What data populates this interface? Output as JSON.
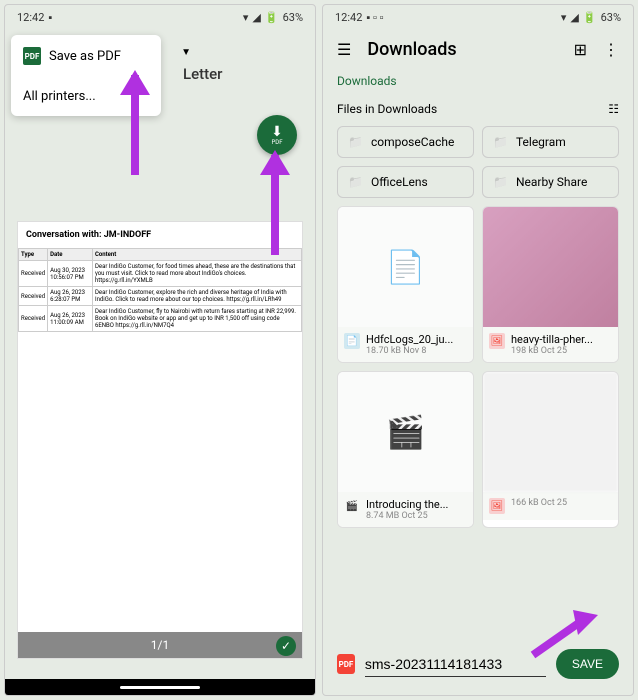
{
  "status": {
    "time": "12:42",
    "battery": "63%"
  },
  "left": {
    "dropdown": {
      "save_as_pdf": "Save as PDF",
      "all_printers": "All printers..."
    },
    "paper": "Letter",
    "preview": {
      "title": "Conversation with: JM-INDOFF",
      "headers": [
        "Type",
        "Date",
        "Content"
      ],
      "rows": [
        {
          "type": "Received",
          "date": "Aug 30, 2023 10:56:07 PM",
          "content": "Dear IndiGo Customer, for food times ahead, these are the destinations that you must visit. Click to read more about IndiGo's choices. https://g.rll.in/YXMLB"
        },
        {
          "type": "Received",
          "date": "Aug 26, 2023 6:28:07 PM",
          "content": "Dear IndiGo Customer, explore the rich and diverse heritage of India with IndiGo. Click to read more about our top choices. https://g.rll.in/LRh49"
        },
        {
          "type": "Received",
          "date": "Aug 26, 2023 11:00:09 AM",
          "content": "Dear IndiGo Customer, fly to Nairobi with return fares starting at INR 22,999. Book on IndiGo website or app and get up to INR 1,500 off using code 6ENBO https://g.rll.in/NM7Q4"
        }
      ],
      "page_indicator": "1/1"
    }
  },
  "right": {
    "title": "Downloads",
    "breadcrumb": "Downloads",
    "section_label": "Files in Downloads",
    "folders": [
      {
        "name": "composeCache"
      },
      {
        "name": "Telegram"
      },
      {
        "name": "OfficeLens"
      },
      {
        "name": "Nearby Share"
      }
    ],
    "files": [
      {
        "name": "HdfcLogs_20_ju...",
        "meta": "18.70 kB Nov 8",
        "icon": "blue"
      },
      {
        "name": "heavy-tilla-pher...",
        "meta": "198 kB Oct 25",
        "icon": "red"
      },
      {
        "name": "Introducing the...",
        "meta": "8.74 MB Oct 25",
        "icon": "green"
      },
      {
        "name": "",
        "meta": "166 kB Oct 25",
        "icon": "red"
      }
    ],
    "filename": "sms-20231114181433",
    "save_label": "SAVE"
  }
}
